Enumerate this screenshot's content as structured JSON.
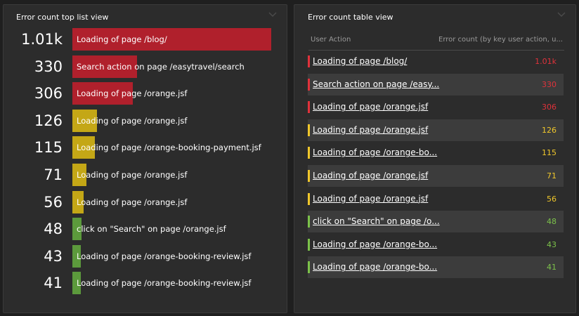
{
  "colors": {
    "red": "#b0202c",
    "yellow": "#c4a716",
    "green": "#5c9a3c",
    "red_text": "#e0323b",
    "yellow_text": "#f0c72b",
    "green_text": "#7cc24a",
    "panel_bg": "#2c2c2c",
    "page_bg": "#1f1f1f"
  },
  "top_list": {
    "title": "Error count top list view",
    "max_value": 1010,
    "items": [
      {
        "value": "1.01k",
        "num": 1010,
        "label": "Loading of page /blog/",
        "status": "red"
      },
      {
        "value": "330",
        "num": 330,
        "label": "Search action on page /easytravel/search",
        "status": "red"
      },
      {
        "value": "306",
        "num": 306,
        "label": "Loading of page /orange.jsf",
        "status": "red"
      },
      {
        "value": "126",
        "num": 126,
        "label": "Loading of page /orange.jsf",
        "status": "yellow"
      },
      {
        "value": "115",
        "num": 115,
        "label": "Loading of page /orange-booking-payment.jsf",
        "status": "yellow"
      },
      {
        "value": "71",
        "num": 71,
        "label": "Loading of page /orange.jsf",
        "status": "yellow"
      },
      {
        "value": "56",
        "num": 56,
        "label": "Loading of page /orange.jsf",
        "status": "yellow"
      },
      {
        "value": "48",
        "num": 48,
        "label": "click on \"Search\" on page /orange.jsf",
        "status": "green"
      },
      {
        "value": "43",
        "num": 43,
        "label": "Loading of page /orange-booking-review.jsf",
        "status": "green"
      },
      {
        "value": "41",
        "num": 41,
        "label": "Loading of page /orange-booking-review.jsf",
        "status": "green"
      }
    ]
  },
  "table": {
    "title": "Error count table view",
    "col_action": "User Action",
    "col_count": "Error count (by key user action, u...",
    "rows": [
      {
        "name": "Loading of page /blog/",
        "value": "1.01k",
        "status": "red"
      },
      {
        "name": "Search action on page /easy...",
        "value": "330",
        "status": "red"
      },
      {
        "name": "Loading of page /orange.jsf",
        "value": "306",
        "status": "red"
      },
      {
        "name": "Loading of page /orange.jsf",
        "value": "126",
        "status": "yellow"
      },
      {
        "name": "Loading of page /orange-bo...",
        "value": "115",
        "status": "yellow"
      },
      {
        "name": "Loading of page /orange.jsf",
        "value": "71",
        "status": "yellow"
      },
      {
        "name": "Loading of page /orange.jsf",
        "value": "56",
        "status": "yellow"
      },
      {
        "name": "click on \"Search\" on page /o...",
        "value": "48",
        "status": "green"
      },
      {
        "name": "Loading of page /orange-bo...",
        "value": "43",
        "status": "green"
      },
      {
        "name": "Loading of page /orange-bo...",
        "value": "41",
        "status": "green"
      }
    ]
  }
}
